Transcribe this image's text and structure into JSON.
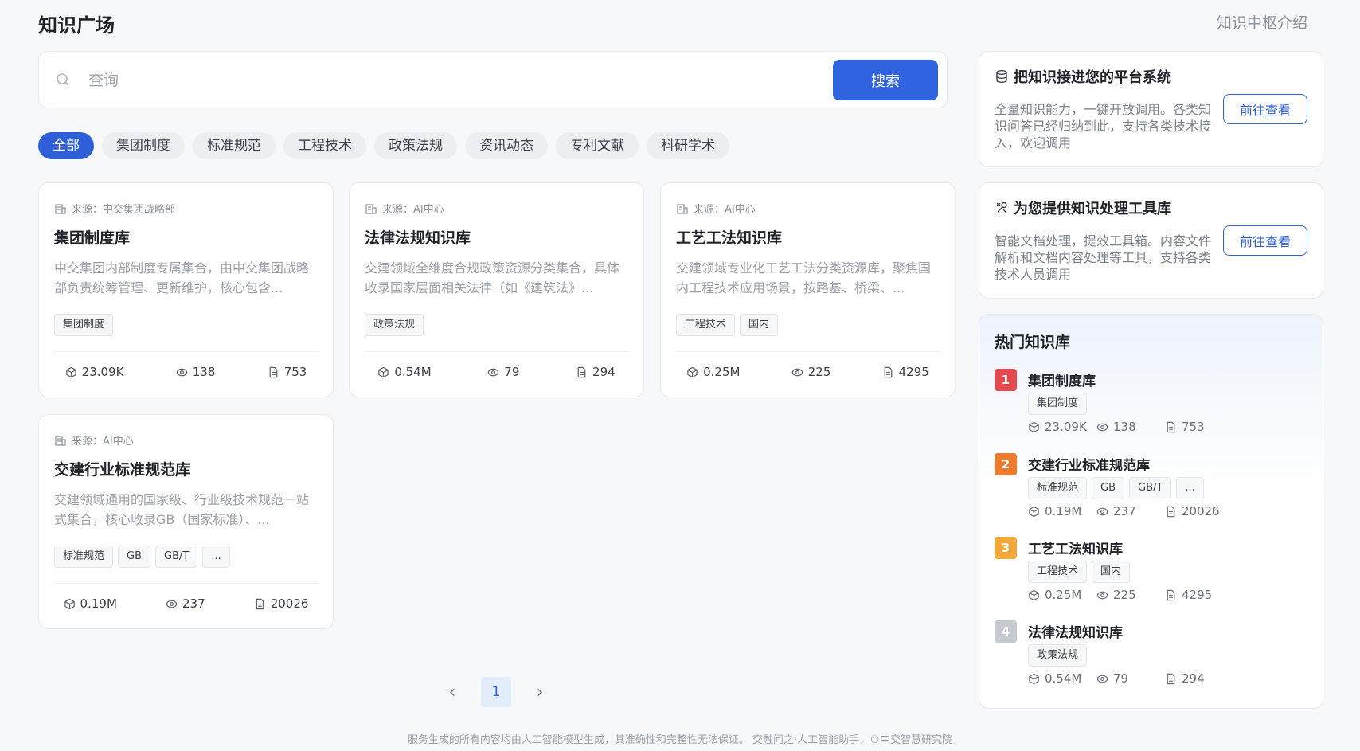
{
  "header": {
    "title": "知识广场",
    "hub_link": "知识中枢介绍"
  },
  "search": {
    "placeholder": "查询",
    "button": "搜索",
    "icon": "search-icon"
  },
  "tabs": [
    {
      "label": "全部",
      "active": true
    },
    {
      "label": "集团制度"
    },
    {
      "label": "标准规范"
    },
    {
      "label": "工程技术"
    },
    {
      "label": "政策法规"
    },
    {
      "label": "资讯动态"
    },
    {
      "label": "专利文献"
    },
    {
      "label": "科研学术"
    }
  ],
  "cards": [
    {
      "source": "来源：中交集团战略部",
      "title": "集团制度库",
      "desc": "中交集团内部制度专属集合，由中交集团战略部负责统筹管理、更新维护，核心包含...",
      "tags": [
        "集团制度"
      ],
      "stats": {
        "size": "23.09K",
        "views": "138",
        "docs": "753"
      }
    },
    {
      "source": "来源：AI中心",
      "title": "法律法规知识库",
      "desc": "交建领域全维度合规政策资源分类集合，具体收录国家层面相关法律（如《建筑法》...",
      "tags": [
        "政策法规"
      ],
      "stats": {
        "size": "0.54M",
        "views": "79",
        "docs": "294"
      }
    },
    {
      "source": "来源：AI中心",
      "title": "工艺工法知识库",
      "desc": "交建领域专业化工艺工法分类资源库，聚焦国内工程技术应用场景，按路基、桥梁、...",
      "tags": [
        "工程技术",
        "国内"
      ],
      "stats": {
        "size": "0.25M",
        "views": "225",
        "docs": "4295"
      }
    },
    {
      "source": "来源：AI中心",
      "title": "交建行业标准规范库",
      "desc": "交建领域通用的国家级、行业级技术规范一站式集合，核心收录GB（国家标准）、...",
      "tags": [
        "标准规范",
        "GB",
        "GB/T",
        "..."
      ],
      "stats": {
        "size": "0.19M",
        "views": "237",
        "docs": "20026"
      }
    }
  ],
  "promos": [
    {
      "title": "把知识接进您的平台系统",
      "desc": "全量知识能力，一键开放调用。各类知识问答已经归纳到此，支持各类技术接入，欢迎调用",
      "button": "前往查看",
      "icon": "database-icon"
    },
    {
      "title": "为您提供知识处理工具库",
      "desc": "智能文档处理，提效工具箱。内容文件解析和文档内容处理等工具，支持各类技术人员调用",
      "button": "前往查看",
      "icon": "tools-icon"
    }
  ],
  "hot": {
    "title": "热门知识库",
    "items": [
      {
        "rank": "1",
        "name": "集团制度库",
        "tags": [
          "集团制度"
        ],
        "stats": {
          "size": "23.09K",
          "views": "138",
          "docs": "753"
        },
        "color": "#e5484d"
      },
      {
        "rank": "2",
        "name": "交建行业标准规范库",
        "tags": [
          "标准规范",
          "GB",
          "GB/T",
          "..."
        ],
        "stats": {
          "size": "0.19M",
          "views": "237",
          "docs": "20026"
        },
        "color": "#f07a2e"
      },
      {
        "rank": "3",
        "name": "工艺工法知识库",
        "tags": [
          "工程技术",
          "国内"
        ],
        "stats": {
          "size": "0.25M",
          "views": "225",
          "docs": "4295"
        },
        "color": "#f5a83a"
      },
      {
        "rank": "4",
        "name": "法律法规知识库",
        "tags": [
          "政策法规"
        ],
        "stats": {
          "size": "0.54M",
          "views": "79",
          "docs": "294"
        },
        "color": "#c5c9d0"
      }
    ]
  },
  "pager": {
    "current": "1"
  },
  "footer": "服务生成的所有内容均由人工智能模型生成，其准确性和完整性无法保证。 交融问之·人工智能助手，©中交智慧研究院"
}
